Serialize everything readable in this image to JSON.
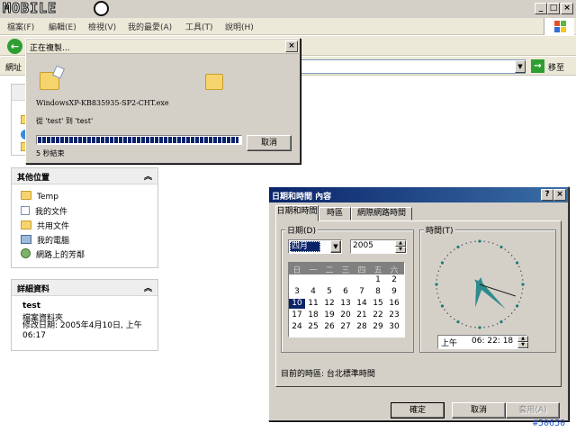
{
  "brand": {
    "logo_text": "MOBILE"
  },
  "menu": [
    "檔案(F)",
    "編輯(E)",
    "檢視(V)",
    "我的最愛(A)",
    "工具(T)",
    "說明(H)"
  ],
  "address": {
    "label": "網址",
    "go_label": "移至"
  },
  "task_pane": {
    "other_places": {
      "title": "其他位置",
      "items": [
        {
          "label": "Temp",
          "icon": "folder-icon"
        },
        {
          "label": "我的文件",
          "icon": "documents-icon"
        },
        {
          "label": "共用文件",
          "icon": "folder-icon"
        },
        {
          "label": "我的電腦",
          "icon": "computer-icon"
        },
        {
          "label": "網路上的芳鄰",
          "icon": "network-icon"
        }
      ]
    },
    "details": {
      "title": "詳細資料",
      "name": "test",
      "type": "檔案資料夾",
      "modified": "修改日期: 2005年4月10日, 上午 06:17"
    }
  },
  "copy_dialog": {
    "title": "正在複製...",
    "filename": "WindowsXP-KB835935-SP2-CHT.exe",
    "from_to": "從 'test' 到 'test'",
    "remaining": "5 秒結束",
    "progress": 0.99,
    "cancel_label": "取消"
  },
  "datetime_dialog": {
    "title": "日期和時間 內容",
    "help_label": "?",
    "close_label": "×",
    "tabs": [
      "日期和時間",
      "時區",
      "網際網路時間"
    ],
    "date_group_label": "日期(D)",
    "time_group_label": "時間(T)",
    "month": "四月",
    "year": "2005",
    "weekdays": [
      "日",
      "一",
      "二",
      "三",
      "四",
      "五",
      "六"
    ],
    "first_weekday_index": 5,
    "days_in_month": 30,
    "selected_day": 10,
    "time_ampm": "上午",
    "time": "06: 22: 18",
    "clock": {
      "hours": 6,
      "minutes": 22,
      "seconds": 18
    },
    "timezone_text": "目前的時區: 台北標準時間",
    "ok_label": "確定",
    "cancel_label": "取消",
    "apply_label": "套用(A)"
  },
  "watermark": "#50650",
  "colors": {
    "title_active": "#0a246a",
    "selection": "#0a246a",
    "clock_hand": "#2e8b8b",
    "go_green": "#2e9e32"
  }
}
